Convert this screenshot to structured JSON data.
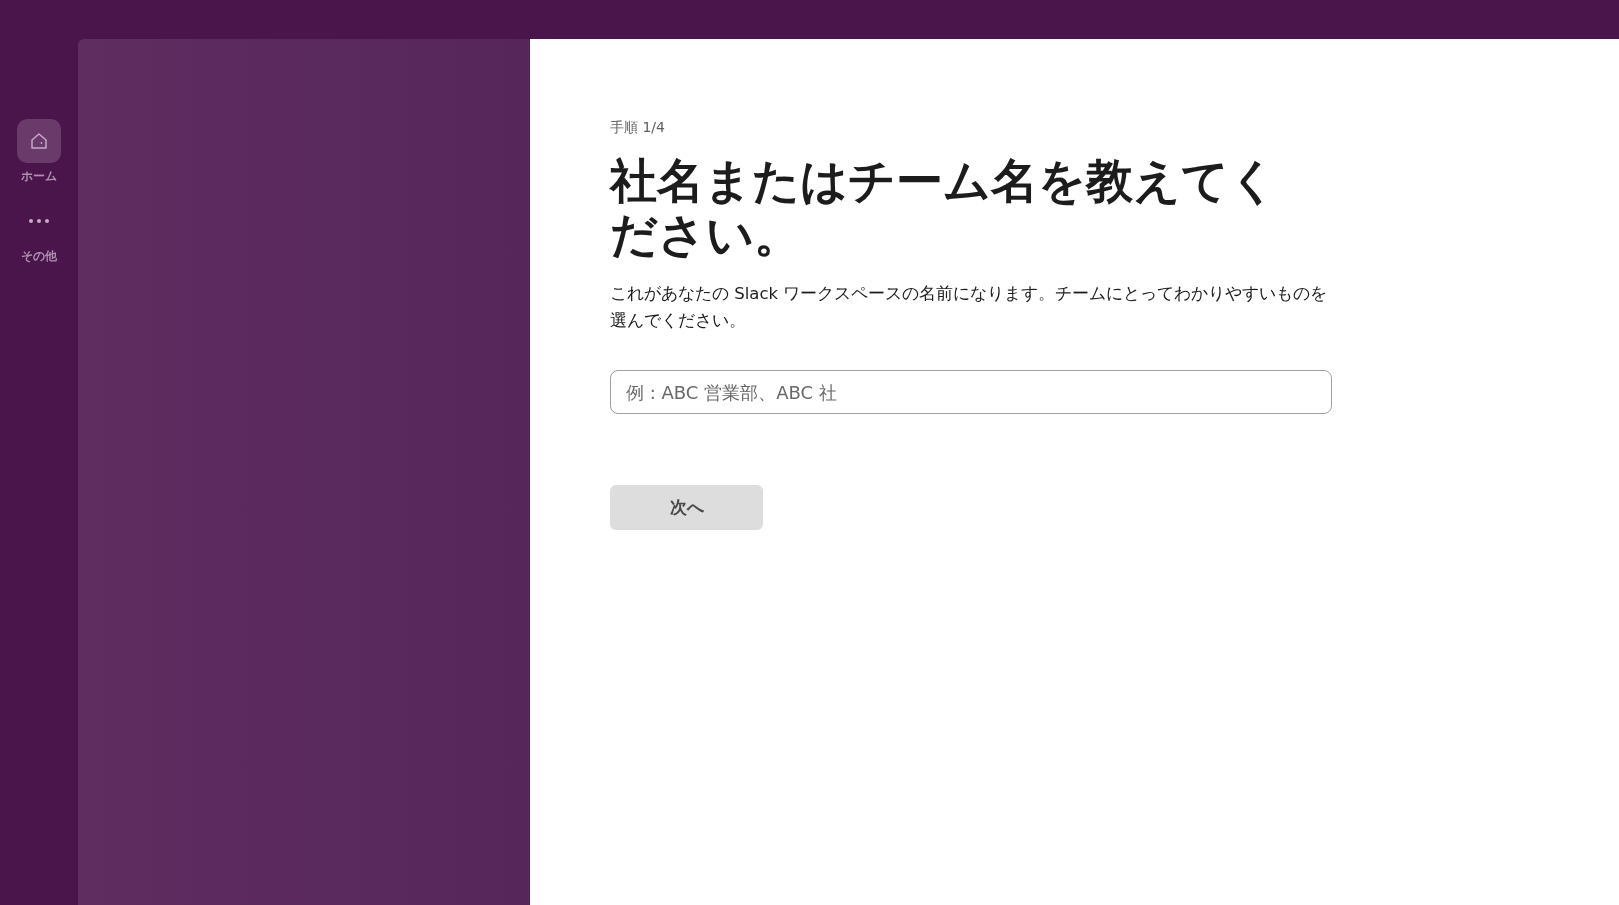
{
  "rail": {
    "items": [
      {
        "kind": "home",
        "label": "ホーム",
        "selected": true
      },
      {
        "kind": "more",
        "label": "その他",
        "selected": false
      }
    ]
  },
  "setup": {
    "step": "手順 1/4",
    "title": "社名またはチーム名を教えてください。",
    "description": "これがあなたの Slack ワークスペースの名前になります。チームにとってわかりやすいものを選んでください。",
    "name_field": {
      "placeholder": "例 : ABC 営業部、ABC 社"
    },
    "next_button": {
      "label": "次へ",
      "disabled": true
    }
  }
}
